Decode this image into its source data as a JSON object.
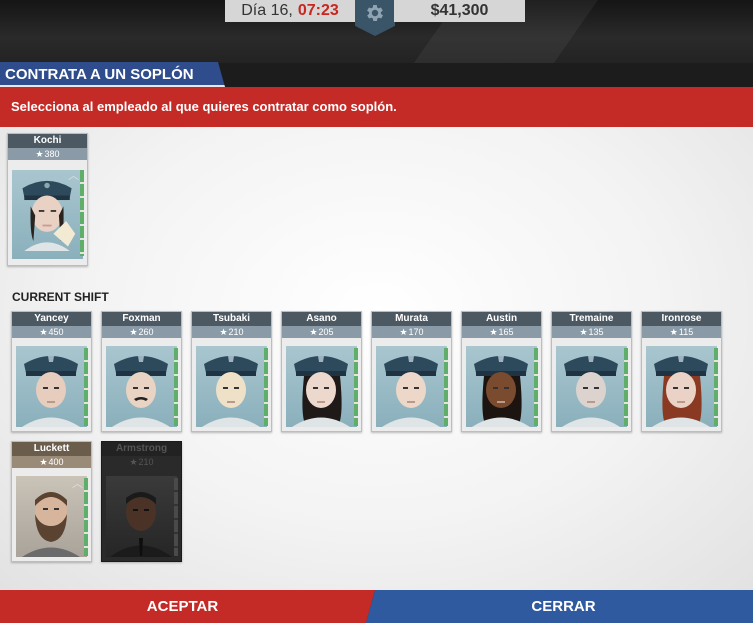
{
  "topbar": {
    "day_label": "Día 16,",
    "time": "07:23",
    "money": "$41,300"
  },
  "header": {
    "title": "CONTRATA A UN SOPLÓN",
    "subtitle": "Selecciona al empleado al que quieres contratar como soplón."
  },
  "selected": {
    "name": "Kochi",
    "score": "380"
  },
  "current_shift": {
    "label": "CURRENT SHIFT",
    "officers": [
      {
        "name": "Yancey",
        "score": "450"
      },
      {
        "name": "Foxman",
        "score": "260"
      },
      {
        "name": "Tsubaki",
        "score": "210"
      },
      {
        "name": "Asano",
        "score": "205"
      },
      {
        "name": "Murata",
        "score": "170"
      },
      {
        "name": "Austin",
        "score": "165"
      },
      {
        "name": "Tremaine",
        "score": "135"
      },
      {
        "name": "Ironrose",
        "score": "115"
      }
    ],
    "others": [
      {
        "name": "Luckett",
        "score": "400"
      },
      {
        "name": "Armstrong",
        "score": "210"
      }
    ]
  },
  "buttons": {
    "accept": "ACEPTAR",
    "close": "CERRAR"
  },
  "colors": {
    "red": "#c42a26",
    "blue": "#2f5aa0",
    "navy": "#2f4c8c"
  },
  "icons": {
    "settings": "gear-icon",
    "score": "star-icon"
  }
}
